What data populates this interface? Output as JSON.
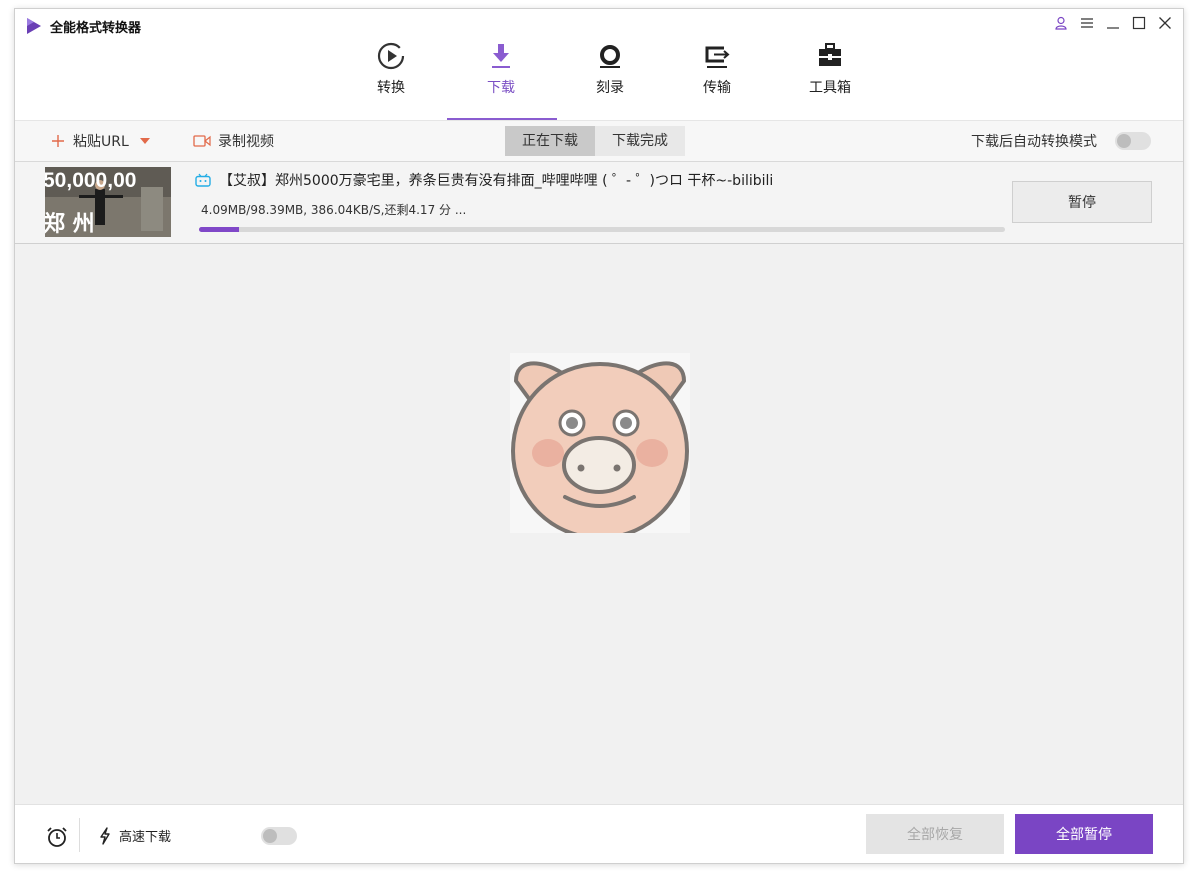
{
  "app": {
    "title": "全能格式转换器"
  },
  "nav": {
    "tabs": [
      {
        "label": "转换",
        "icon": "convert-icon"
      },
      {
        "label": "下载",
        "icon": "download-icon",
        "active": true
      },
      {
        "label": "刻录",
        "icon": "burn-icon"
      },
      {
        "label": "传输",
        "icon": "transfer-icon"
      },
      {
        "label": "工具箱",
        "icon": "toolbox-icon"
      }
    ]
  },
  "toolbar": {
    "paste_url": "粘贴URL",
    "record_video": "录制视频",
    "segments": [
      "正在下载",
      "下载完成"
    ],
    "auto_convert_label": "下载后自动转换模式"
  },
  "download": {
    "title": "【艾叔】郑州5000万豪宅里，养条巨贵有没有排面_哔哩哔哩 ( ゜- ゜)つロ 干杯~-bilibili",
    "status": "4.09MB/98.39MB, 386.04KB/S,还剩4.17 分 ...",
    "progress": 0.05,
    "pause_label": "暂停",
    "thumb_text_top": "50,000,00",
    "thumb_text_bottom": "郑  州"
  },
  "bottom": {
    "high_speed_label": "高速下载",
    "resume_all": "全部恢复",
    "pause_all": "全部暂停"
  },
  "colors": {
    "accent": "#7a45c4",
    "progress": "#8048c8",
    "bilibili": "#23ade5"
  }
}
